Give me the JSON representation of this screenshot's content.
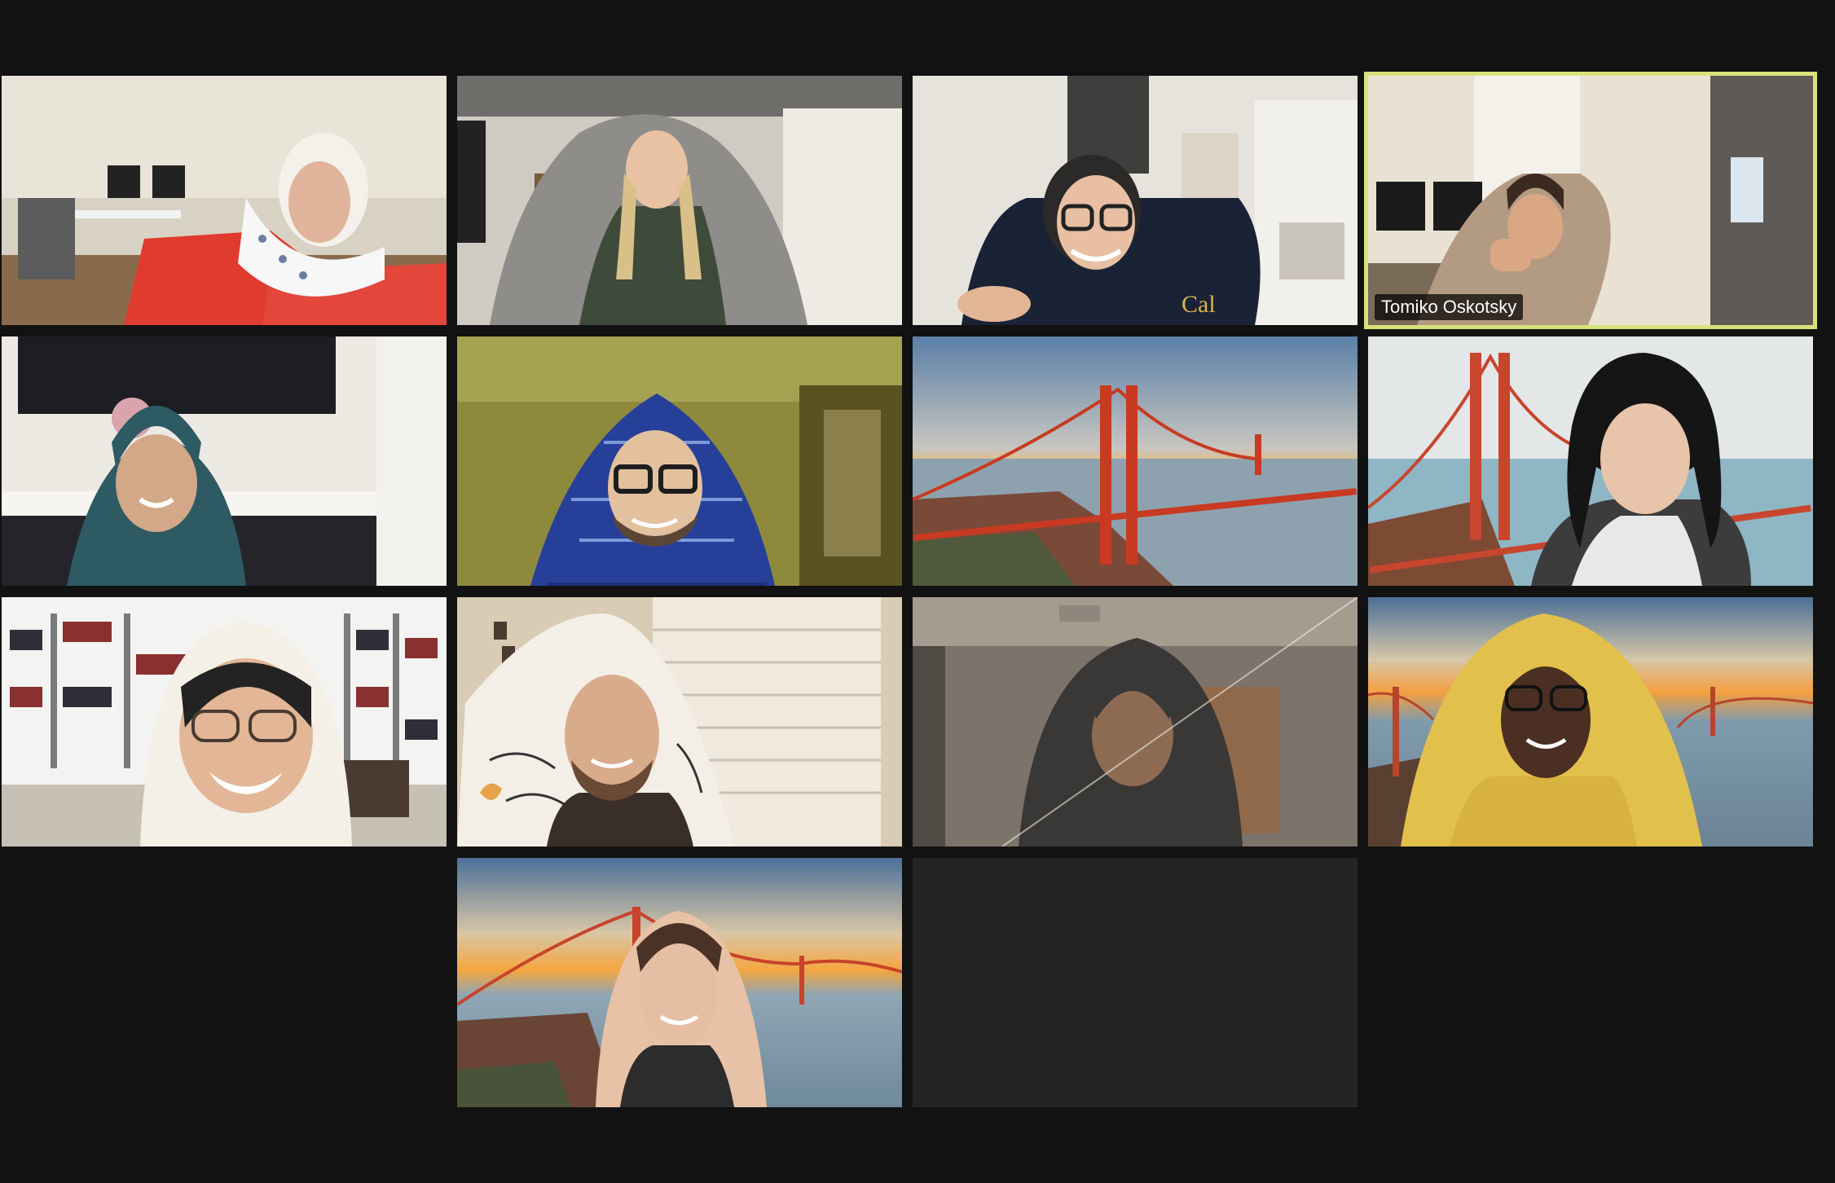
{
  "meeting": {
    "active_speaker": "Tomiko Oskotsky"
  },
  "colors": {
    "window_background": "#121212",
    "active_speaker_border": "#d7e27a",
    "empty_tile": "#242424"
  },
  "participants": [
    {
      "slot": 1,
      "background": "home-office",
      "covering": "white-dotted-blanket"
    },
    {
      "slot": 2,
      "background": "apartment-room",
      "covering": "gray-fleece-blanket"
    },
    {
      "slot": 3,
      "background": "home-office",
      "covering": "navy-hoodie-with-headset"
    },
    {
      "slot": 4,
      "background": "bedroom-doorway",
      "covering": "beige-blanket",
      "name": "Tomiko Oskotsky"
    },
    {
      "slot": 5,
      "background": "kitchen",
      "covering": "teal-blanket"
    },
    {
      "slot": 6,
      "background": "yellow-wall-room",
      "covering": "blue-plaid-blanket"
    },
    {
      "slot": 7,
      "background": "virtual-golden-gate-bridge",
      "covering": "camera-off"
    },
    {
      "slot": 8,
      "background": "virtual-golden-gate-bridge",
      "covering": "houndstooth-jacket"
    },
    {
      "slot": 9,
      "background": "bookshelf-library",
      "covering": "white-hooded-blanket"
    },
    {
      "slot": 10,
      "background": "window-blinds-room",
      "covering": "white-script-blanket"
    },
    {
      "slot": 11,
      "background": "dim-room",
      "covering": "dark-fleece-blanket"
    },
    {
      "slot": 12,
      "background": "virtual-golden-gate-bridge",
      "covering": "yellow-towel"
    },
    {
      "slot": 13,
      "background": "virtual-golden-gate-bridge",
      "covering": "pink-sherpa-blanket"
    }
  ]
}
